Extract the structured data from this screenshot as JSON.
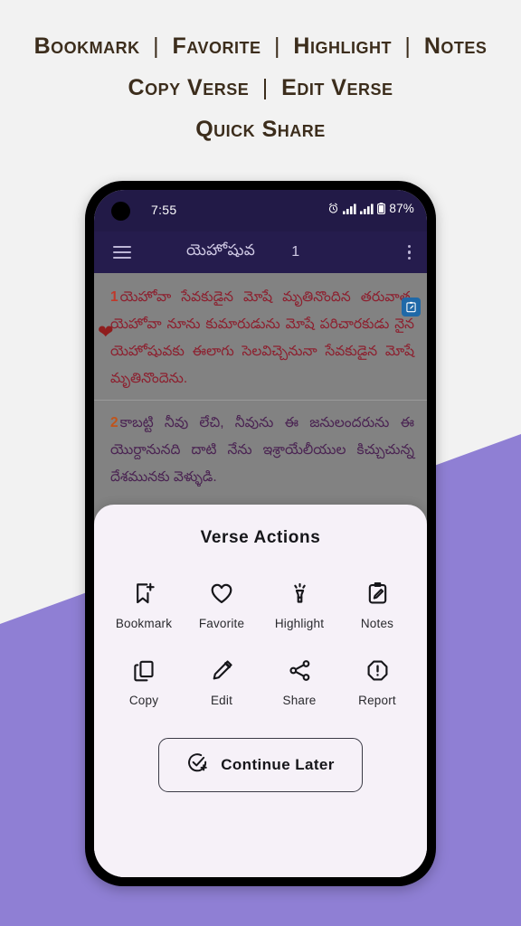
{
  "promo": {
    "line1": [
      "Bookmark",
      "Favorite",
      "Highlight",
      "Notes"
    ],
    "line2": [
      "Copy Verse",
      "Edit Verse"
    ],
    "line3": [
      "Quick Share"
    ],
    "separator": "|",
    "text_color": "#3c2d1c"
  },
  "background": {
    "base_color": "#f2f2f2",
    "band_color": "#8f7fd4"
  },
  "phone": {
    "status_bar": {
      "time": "7:55",
      "battery_percent": "87%",
      "icons": [
        "alarm-icon",
        "signal-bars-icon",
        "signal-bars-icon",
        "battery-icon"
      ],
      "background_color": "#221a47"
    },
    "app_bar": {
      "menu_icon": "hamburger-icon",
      "title": "యెహోషువ",
      "chapter": "1",
      "overflow_icon": "kebab-menu-icon",
      "background_color": "#251c4d"
    },
    "verses": [
      {
        "number": "1",
        "text": "యెహోవా సేవకుడైన మోషే మృతినొందిన తరువాత, యెహోవా నూను కుమారుడును మోషే పరిచారకుడు నైన యెహోషువకు ఈలాగు సెలవిచ్చెనునా సేవకుడైన మోషే మృతినొందెను.",
        "number_color": "#c0392b",
        "text_color": "#8d1f2e",
        "favorited": true,
        "favorite_icon": "heart-icon"
      },
      {
        "number": "2",
        "text": "కాబట్టి నీవు లేచి, నీవును ఈ జనులందరును ఈ యొర్దానునది దాటి నేను ఇశ్రాయేలీయుల కిచ్చుచున్న దేశమునకు వెళ్ళుడి.",
        "number_color": "#c0541b",
        "text_color": "#4a2352",
        "has_note": true,
        "note_icon": "note-edit-badge-icon",
        "note_badge_color": "#1f69a8"
      }
    ],
    "sheet": {
      "title": "Verse Actions",
      "background_color": "#f6f1f8",
      "actions_row_1": [
        {
          "icon": "bookmark-add-icon",
          "label": "Bookmark"
        },
        {
          "icon": "heart-outline-icon",
          "label": "Favorite"
        },
        {
          "icon": "highlighter-icon",
          "label": "Highlight"
        },
        {
          "icon": "notes-clipboard-pencil-icon",
          "label": "Notes"
        }
      ],
      "actions_row_2": [
        {
          "icon": "copy-icon",
          "label": "Copy"
        },
        {
          "icon": "pencil-icon",
          "label": "Edit"
        },
        {
          "icon": "share-nodes-icon",
          "label": "Share"
        },
        {
          "icon": "report-octagon-icon",
          "label": "Report"
        }
      ],
      "continue_button": {
        "label": "Continue Later",
        "icon": "check-circle-plus-icon"
      }
    }
  }
}
